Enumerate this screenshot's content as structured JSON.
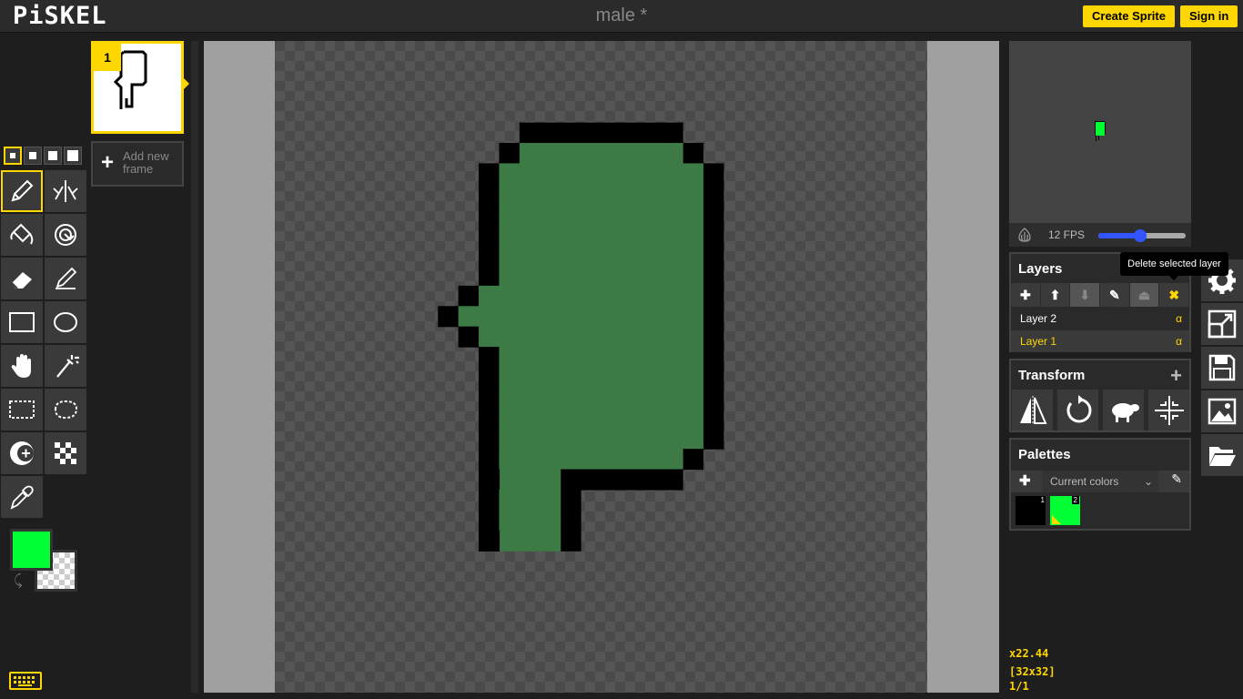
{
  "header": {
    "logo": "PiSKEL",
    "title": "male *",
    "create_sprite": "Create Sprite",
    "sign_in": "Sign in"
  },
  "tools": {
    "pen_sizes": [
      1,
      2,
      3,
      4
    ],
    "selected_pen_size": 1,
    "items": [
      {
        "name": "pen-tool",
        "icon": "pencil-icon",
        "selected": true
      },
      {
        "name": "vertical-mirror-pen-tool",
        "icon": "mirror-pen-icon"
      },
      {
        "name": "paint-bucket-tool",
        "icon": "paint-bucket-icon"
      },
      {
        "name": "paint-all-same-color-tool",
        "icon": "color-swap-bucket-icon"
      },
      {
        "name": "eraser-tool",
        "icon": "eraser-icon"
      },
      {
        "name": "stroke-tool",
        "icon": "line-icon"
      },
      {
        "name": "rectangle-tool",
        "icon": "rectangle-icon"
      },
      {
        "name": "circle-tool",
        "icon": "circle-icon"
      },
      {
        "name": "move-tool",
        "icon": "hand-icon"
      },
      {
        "name": "shape-selection-tool",
        "icon": "magic-wand-icon"
      },
      {
        "name": "rectangle-selection-tool",
        "icon": "dashed-rectangle-icon"
      },
      {
        "name": "lasso-selection-tool",
        "icon": "lasso-icon"
      },
      {
        "name": "lighten-tool",
        "icon": "lighten-icon"
      },
      {
        "name": "dithering-tool",
        "icon": "checkerboard-icon"
      },
      {
        "name": "color-picker-tool",
        "icon": "eyedropper-icon"
      }
    ],
    "primary_color": "#00ff33",
    "secondary_color": "transparent"
  },
  "frames": {
    "items": [
      {
        "number": "1"
      }
    ],
    "add_frame_label": "Add new frame"
  },
  "preview": {
    "fps_label": "12 FPS",
    "fps": 12
  },
  "layers": {
    "title": "Layers",
    "toolbar": [
      {
        "name": "add-layer-button",
        "icon": "plus-icon"
      },
      {
        "name": "move-layer-up-button",
        "icon": "arrow-up-icon"
      },
      {
        "name": "move-layer-down-button",
        "icon": "arrow-down-icon",
        "disabled": true
      },
      {
        "name": "rename-layer-button",
        "icon": "pencil-icon"
      },
      {
        "name": "merge-layer-button",
        "icon": "merge-down-icon",
        "disabled": true
      },
      {
        "name": "delete-layer-button",
        "icon": "close-icon"
      }
    ],
    "items": [
      {
        "label": "Layer 2",
        "alpha": "α",
        "selected": false
      },
      {
        "label": "Layer 1",
        "alpha": "α",
        "selected": true
      }
    ],
    "tooltip": "Delete selected layer"
  },
  "transform": {
    "title": "Transform",
    "buttons": [
      "flip-icon",
      "rotate-icon",
      "sheep-icon",
      "center-icon"
    ]
  },
  "palettes": {
    "title": "Palettes",
    "selected": "Current colors",
    "colors": [
      {
        "index": "1",
        "hex": "#000000"
      },
      {
        "index": "2",
        "hex": "#00ff33"
      }
    ]
  },
  "settings": {
    "buttons": [
      "gear-icon",
      "resize-icon",
      "save-icon",
      "export-image-icon",
      "open-folder-icon"
    ]
  },
  "status": {
    "zoom": "x22.44",
    "size": "[32x32]",
    "frame": "1/1"
  },
  "colors": {
    "accent": "#ffd700",
    "sprite_fill": "#3c7a46",
    "sprite_outline": "#000000"
  }
}
